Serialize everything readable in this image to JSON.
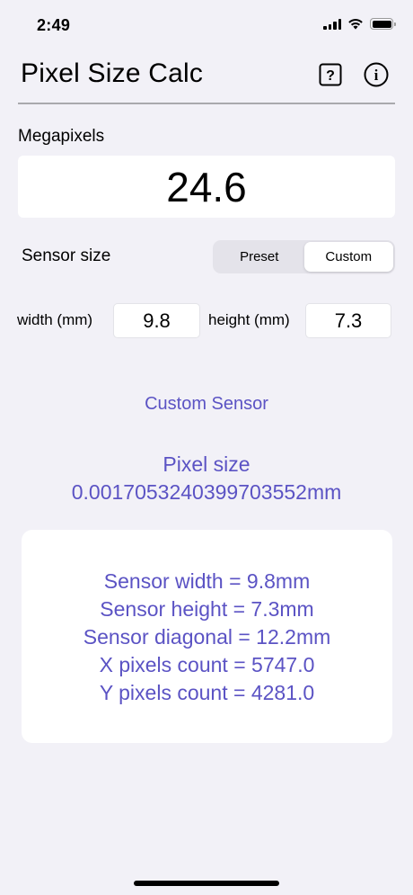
{
  "status_bar": {
    "time": "2:49",
    "icons": [
      "cellular-signal-icon",
      "wifi-icon",
      "battery-icon"
    ]
  },
  "nav": {
    "title": "Pixel Size Calc",
    "help_icon_glyph": "?",
    "info_icon_glyph": "i"
  },
  "megapixels": {
    "label": "Megapixels",
    "value": "24.6"
  },
  "sensor": {
    "label": "Sensor size",
    "segments": [
      "Preset",
      "Custom"
    ],
    "selected": "Custom"
  },
  "dimensions": {
    "width_label": "width (mm)",
    "width_value": "9.8",
    "height_label": "height (mm)",
    "height_value": "7.3"
  },
  "result": {
    "sensor_name": "Custom Sensor",
    "pixel_size_label": "Pixel size",
    "pixel_size_value": "0.0017053240399703552mm",
    "lines": [
      "Sensor width = 9.8mm",
      "Sensor height = 7.3mm",
      "Sensor diagonal = 12.2mm",
      "X pixels count = 5747.0",
      "Y pixels count = 4281.0"
    ]
  },
  "colors": {
    "accent": "#5b53c4",
    "background": "#f2f1f7"
  }
}
